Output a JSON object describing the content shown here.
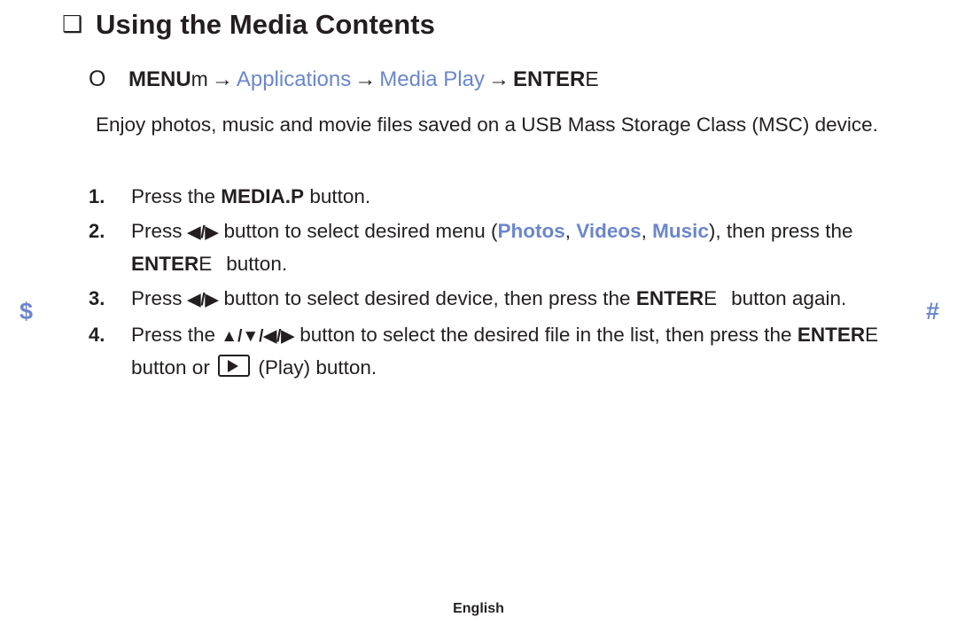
{
  "page": {
    "title": {
      "marker_icon": "checkbox-outline-glyph",
      "marker": "❑",
      "text": "Using the Media Contents"
    },
    "menu_path": {
      "marker_icon": "circle-outline-glyph",
      "marker": "O",
      "key_bold": "MENU",
      "key_light": "m",
      "arrow1": "→",
      "link1": "Applications",
      "arrow2": "→",
      "link2": "Media Play",
      "arrow3": "→",
      "enter_bold": "ENTER",
      "enter_light": "E"
    },
    "intro": "Enjoy photos, music and movie files saved on a USB Mass Storage Class (MSC) device.",
    "steps": [
      {
        "number": "1.",
        "seg_a": "Press the ",
        "button_bold": "MEDIA.P",
        "seg_b": " button."
      },
      {
        "number": "2.",
        "seg_a": "Press ",
        "nav": "◀/▶",
        "seg_b": " button to select desired menu (",
        "opt1": "Photos",
        "sep1": ", ",
        "opt2": "Videos",
        "sep2": ", ",
        "opt3": "Music",
        "seg_c": "), then press the ",
        "enter_bold": "ENTER",
        "enter_light": "E",
        "seg_d": "button."
      },
      {
        "number": "3.",
        "seg_a": "Press ",
        "nav": "◀/▶",
        "seg_b": " button to select desired device, then press the ",
        "enter_bold": "ENTER",
        "enter_light": "E",
        "seg_c": "button again."
      },
      {
        "number": "4.",
        "seg_a": "Press the ",
        "nav": "▲/▼/◀/▶",
        "seg_b": " button to select the desired file in the list, then press the ",
        "enter_bold": "ENTER",
        "enter_light": "E",
        "seg_c": "button or ",
        "play_icon": "play-button-icon",
        "seg_d": " (Play) button."
      }
    ],
    "margin_markers": {
      "left": "$",
      "right": "#"
    },
    "footer": "English",
    "colors": {
      "accent_blue": "#6b86cc",
      "text": "#231f20"
    }
  }
}
